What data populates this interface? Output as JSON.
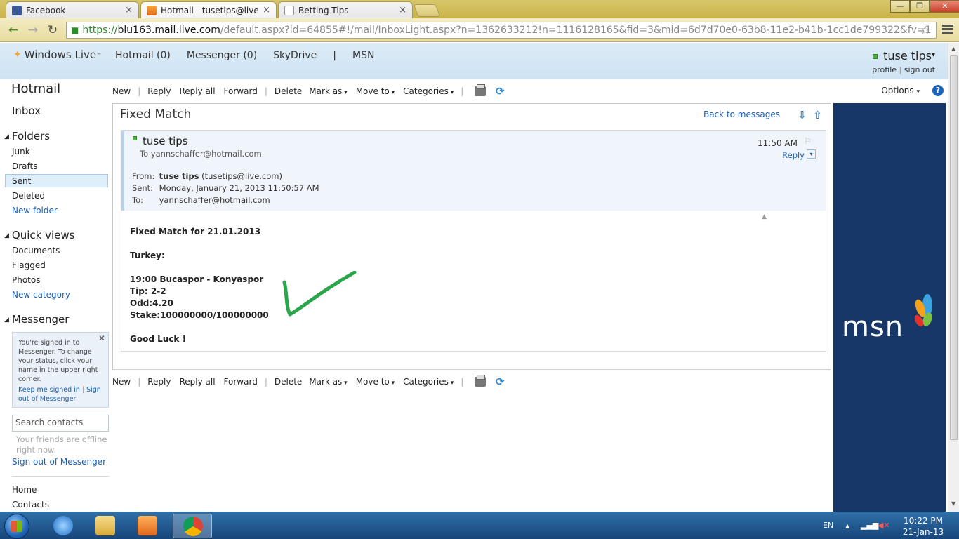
{
  "browser": {
    "tabs": [
      {
        "title": "Facebook",
        "close": "×"
      },
      {
        "title": "Hotmail - tusetips@live.c",
        "close": "×"
      },
      {
        "title": "Betting Tips",
        "close": "×"
      }
    ],
    "url": {
      "scheme": "https://",
      "host": "blu163.mail.live.com",
      "path": "/default.aspx?id=64855#!/mail/InboxLight.aspx?n=1362633212!n=1116128165&fid=3&mid=6d7d70e0-63b8-11e2-b41b-1cc1de799322&fv=1"
    },
    "controls": {
      "minimize": "—",
      "maximize": "❐",
      "close": "✕"
    }
  },
  "header": {
    "brand": "Windows Live",
    "brand_tm": "™",
    "nav": [
      "Hotmail (0)",
      "Messenger (0)",
      "SkyDrive",
      "|",
      "MSN"
    ],
    "user_name": "tuse tips",
    "user_caret": "▾",
    "profile": "profile",
    "link_sep": "|",
    "signout": "sign out"
  },
  "sidebar": {
    "title": "Hotmail",
    "inbox": "Inbox",
    "folders_head": "Folders",
    "folders": [
      "Junk",
      "Drafts",
      "Sent",
      "Deleted"
    ],
    "new_folder": "New folder",
    "quick_head": "Quick views",
    "quick": [
      "Documents",
      "Flagged",
      "Photos"
    ],
    "new_category": "New category",
    "messenger_head": "Messenger",
    "messenger_msg": "You're signed in to Messenger. To change your status, click your name in the upper right corner.",
    "keep_signed": "Keep me signed in",
    "msg_sep": "|",
    "msg_signout": "Sign out of Messenger",
    "search_contacts": "Search contacts",
    "offline": "Your friends are offline right now.",
    "signout_messenger": "Sign out of Messenger",
    "bottom": [
      "Home",
      "Contacts"
    ]
  },
  "commands": {
    "new": "New",
    "reply": "Reply",
    "reply_all": "Reply all",
    "forward": "Forward",
    "delete": "Delete",
    "mark_as": "Mark as",
    "move_to": "Move to",
    "categories": "Categories",
    "options": "Options",
    "help": "?"
  },
  "message": {
    "subject": "Fixed Match",
    "back": "Back to messages",
    "sender": "tuse tips",
    "to_line": "To yannschaffer@hotmail.com",
    "time": "11:50 AM",
    "reply": "Reply",
    "from_label": "From:",
    "from_name": "tuse tips",
    "from_email": "(tusetips@live.com)",
    "sent_label": "Sent:",
    "sent_value": "Monday, January 21, 2013 11:50:57 AM",
    "to_label": "To:",
    "to_value": "yannschaffer@hotmail.com",
    "body": {
      "line1": "Fixed Match for 21.01.2013",
      "line2": "Turkey:",
      "line3": "19:00 Bucaspor - Konyaspor",
      "line4": "Tip: 2-2",
      "line5": "Odd:4.20",
      "line6": "Stake:100000000/100000000",
      "line7": "Good Luck !"
    }
  },
  "ad": {
    "logo": "msn"
  },
  "taskbar": {
    "lang": "EN",
    "time": "10:22 PM",
    "date": "21-Jan-13"
  },
  "colors": {
    "accent": "#1a5fb4",
    "msn_bg": "#163768",
    "status_online": "#4db33d"
  }
}
